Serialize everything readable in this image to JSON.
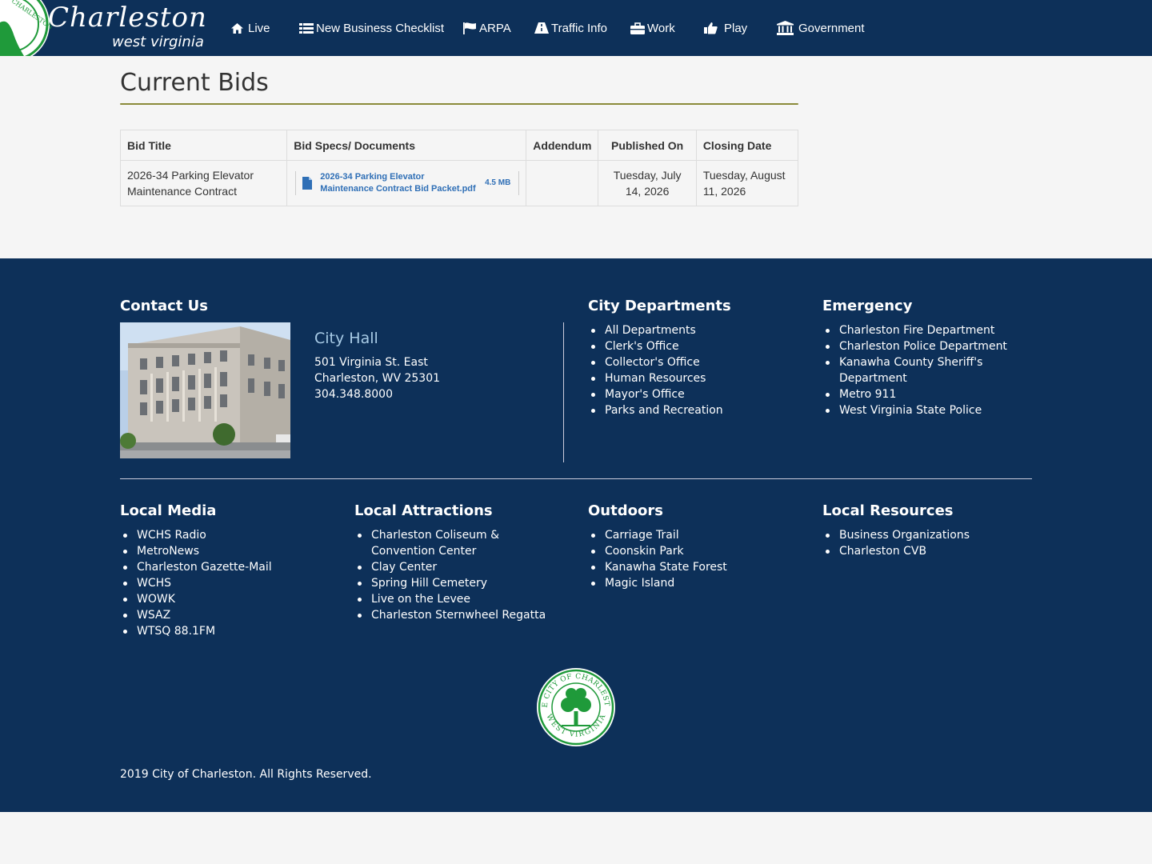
{
  "header": {
    "logo_name": "Charleston",
    "logo_state": "west virginia",
    "nav": [
      {
        "label": "Live",
        "icon": "home-icon"
      },
      {
        "label": "New Business Checklist",
        "icon": "list-icon"
      },
      {
        "label": "ARPA",
        "icon": "flag-icon"
      },
      {
        "label": "Traffic Info",
        "icon": "road-icon"
      },
      {
        "label": "Work",
        "icon": "briefcase-icon"
      },
      {
        "label": "Play",
        "icon": "thumbs-up-icon"
      },
      {
        "label": "Government",
        "icon": "institution-icon"
      }
    ]
  },
  "main": {
    "title": "Current Bids",
    "table": {
      "headers": [
        "Bid Title",
        "Bid Specs/ Documents",
        "Addendum",
        "Published On",
        "Closing Date"
      ],
      "rows": [
        {
          "title": "2026-34 Parking Elevator Maintenance Contract",
          "doc_name": "2026-34 Parking Elevator Maintenance Contract Bid Packet.pdf",
          "doc_size": "4.5 MB",
          "addendum": "",
          "published": "Tuesday, July 14, 2026",
          "closing": "Tuesday, August 11, 2026"
        }
      ]
    }
  },
  "footer": {
    "contact": {
      "heading": "Contact Us",
      "place": "City Hall",
      "address_line1": "501 Virginia St. East",
      "address_line2": "Charleston, WV 25301",
      "phone": "304.348.8000"
    },
    "city_departments": {
      "heading": "City Departments",
      "items": [
        "All Departments",
        "Clerk's Office",
        "Collector's Office",
        "Human Resources",
        "Mayor's Office",
        "Parks and Recreation"
      ]
    },
    "emergency": {
      "heading": "Emergency",
      "items": [
        "Charleston Fire Department",
        "Charleston Police Department",
        "Kanawha County Sheriff's Department",
        "Metro 911",
        "West Virginia State Police"
      ]
    },
    "local_media": {
      "heading": "Local Media",
      "items": [
        "WCHS Radio",
        "MetroNews",
        "Charleston Gazette-Mail",
        "WCHS",
        "WOWK",
        "WSAZ",
        "WTSQ 88.1FM"
      ]
    },
    "local_attractions": {
      "heading": "Local Attractions",
      "items": [
        "Charleston Coliseum & Convention Center",
        "Clay Center",
        "Spring Hill Cemetery",
        "Live on the Levee",
        "Charleston Sternwheel Regatta"
      ]
    },
    "outdoors": {
      "heading": "Outdoors",
      "items": [
        "Carriage Trail",
        "Coonskin Park",
        "Kanawha State Forest",
        "Magic Island"
      ]
    },
    "local_resources": {
      "heading": "Local Resources",
      "items": [
        "Business Organizations",
        "Charleston CVB"
      ]
    },
    "seal_text_top": "THE CITY OF CHARLESTON",
    "seal_text_bottom": "WEST VIRGINIA",
    "copyright": "2019 City of Charleston. All Rights Reserved."
  },
  "colors": {
    "navy": "#0d3059",
    "seal_green": "#1f9a3a",
    "link_blue": "#2f6fb6"
  }
}
